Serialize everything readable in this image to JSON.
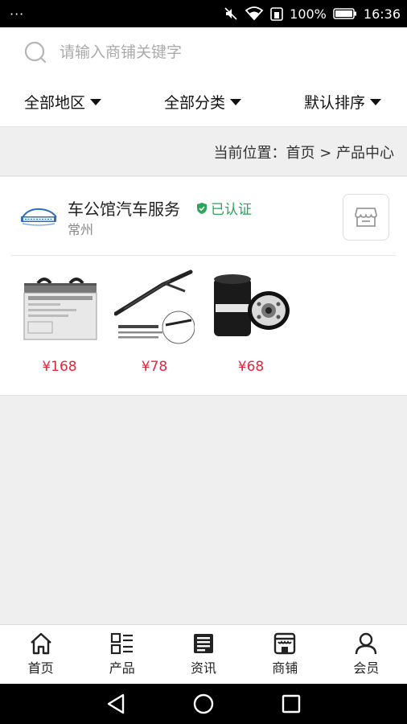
{
  "status_bar": {
    "dots": "···",
    "battery": "100%",
    "time": "16:36"
  },
  "search": {
    "placeholder": "请输入商铺关键字",
    "value": ""
  },
  "filters": [
    {
      "label": "全部地区"
    },
    {
      "label": "全部分类"
    },
    {
      "label": "默认排序"
    }
  ],
  "breadcrumb": "当前位置：首页 > 产品中心",
  "shop": {
    "name": "车公馆汽车服务",
    "badge": "已认证",
    "city": "常州",
    "products": [
      {
        "price": "¥168",
        "image": "battery"
      },
      {
        "price": "¥78",
        "image": "wiper-arm"
      },
      {
        "price": "¥68",
        "image": "oil-filter"
      }
    ]
  },
  "bottom_nav": [
    {
      "label": "首页",
      "icon": "home-icon"
    },
    {
      "label": "产品",
      "icon": "product-list-icon"
    },
    {
      "label": "资讯",
      "icon": "news-icon"
    },
    {
      "label": "商铺",
      "icon": "store-icon"
    },
    {
      "label": "会员",
      "icon": "user-icon"
    }
  ],
  "colors": {
    "price": "#e5263d",
    "verified": "#2aa55a"
  }
}
